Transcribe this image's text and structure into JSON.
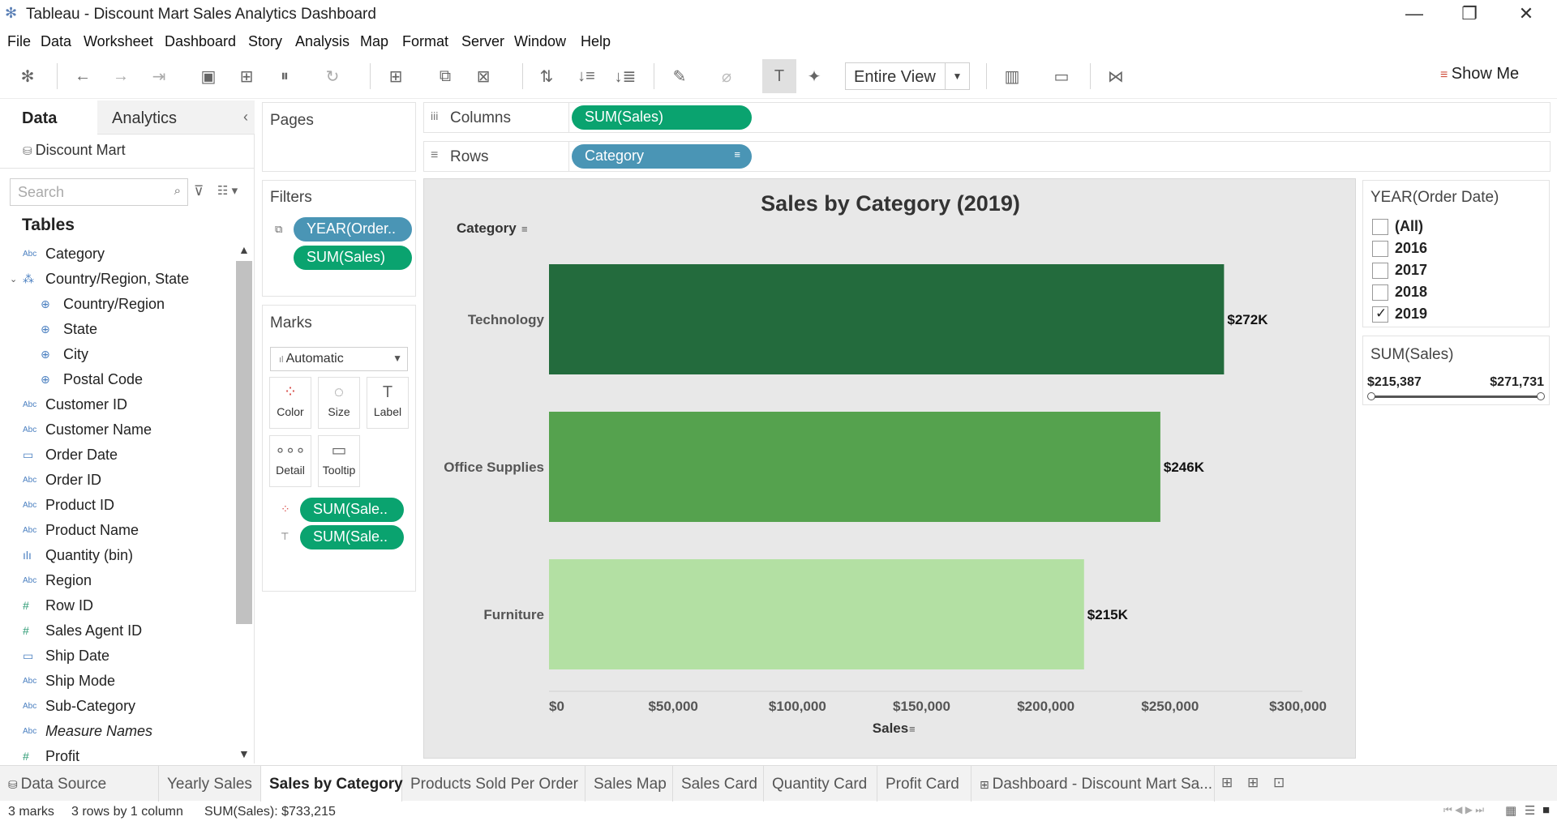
{
  "window": {
    "title": "Tableau - Discount Mart Sales Analytics Dashboard",
    "min": "—",
    "max": "❐",
    "close": "✕"
  },
  "menu": [
    "File",
    "Data",
    "Worksheet",
    "Dashboard",
    "Story",
    "Analysis",
    "Map",
    "Format",
    "Server",
    "Window",
    "Help"
  ],
  "toolbar": {
    "fit": "Entire View",
    "show_me": "Show Me"
  },
  "data_pane": {
    "tab_data": "Data",
    "tab_analytics": "Analytics",
    "collapse": "‹",
    "datasource": "Discount Mart",
    "search_placeholder": "Search",
    "tables_heading": "Tables",
    "fields": [
      {
        "icon": "Abc",
        "label": "Category"
      },
      {
        "icon": "⁂",
        "label": "Country/Region, State"
      },
      {
        "icon": "⊕",
        "label": "Country/Region"
      },
      {
        "icon": "⊕",
        "label": "State"
      },
      {
        "icon": "⊕",
        "label": "City"
      },
      {
        "icon": "⊕",
        "label": "Postal Code"
      },
      {
        "icon": "Abc",
        "label": "Customer ID"
      },
      {
        "icon": "Abc",
        "label": "Customer Name"
      },
      {
        "icon": "▭",
        "label": "Order Date"
      },
      {
        "icon": "Abc",
        "label": "Order ID"
      },
      {
        "icon": "Abc",
        "label": "Product ID"
      },
      {
        "icon": "Abc",
        "label": "Product Name"
      },
      {
        "icon": "ılı",
        "label": "Quantity (bin)"
      },
      {
        "icon": "Abc",
        "label": "Region"
      },
      {
        "icon": "#",
        "label": "Row ID"
      },
      {
        "icon": "#",
        "label": "Sales Agent ID"
      },
      {
        "icon": "▭",
        "label": "Ship Date"
      },
      {
        "icon": "Abc",
        "label": "Ship Mode"
      },
      {
        "icon": "Abc",
        "label": "Sub-Category"
      },
      {
        "icon": "Abc",
        "label": "Measure Names"
      },
      {
        "icon": "#",
        "label": "Profit"
      }
    ]
  },
  "cards": {
    "pages": "Pages",
    "filters": "Filters",
    "filter_pills": [
      "YEAR(Order..",
      "SUM(Sales)"
    ],
    "marks": "Marks",
    "mark_type": "Automatic",
    "mark_buttons": [
      "Color",
      "Size",
      "Label",
      "Detail",
      "Tooltip"
    ],
    "mark_pills": [
      "SUM(Sale..",
      "SUM(Sale.."
    ]
  },
  "shelves": {
    "columns_label": "Columns",
    "columns_pill": "SUM(Sales)",
    "rows_label": "Rows",
    "rows_pill": "Category"
  },
  "chart_data": {
    "type": "bar",
    "title": "Sales by Category (2019)",
    "ylabel": "Category",
    "xlabel": "Sales",
    "categories": [
      "Technology",
      "Office Supplies",
      "Furniture"
    ],
    "values": [
      271731,
      246097,
      215387
    ],
    "data_labels": [
      "$272K",
      "$246K",
      "$215K"
    ],
    "colors": [
      "#236b3d",
      "#55a24e",
      "#b3e0a3"
    ],
    "xlim": [
      0,
      300000
    ],
    "ticks": [
      0,
      50000,
      100000,
      150000,
      200000,
      250000,
      300000
    ],
    "tick_labels": [
      "$0",
      "$50,000",
      "$100,000",
      "$150,000",
      "$200,000",
      "$250,000",
      "$300,000"
    ]
  },
  "year_filter": {
    "title": "YEAR(Order Date)",
    "options": [
      {
        "label": "(All)",
        "checked": false
      },
      {
        "label": "2016",
        "checked": false
      },
      {
        "label": "2017",
        "checked": false
      },
      {
        "label": "2018",
        "checked": false
      },
      {
        "label": "2019",
        "checked": true
      }
    ]
  },
  "sales_filter": {
    "title": "SUM(Sales)",
    "min": "$215,387",
    "max": "$271,731"
  },
  "sheet_tabs": {
    "datasource": "Data Source",
    "tabs": [
      "Yearly Sales",
      "Sales by Category",
      "Products Sold Per Order",
      "Sales Map",
      "Sales Card",
      "Quantity Card",
      "Profit Card",
      "Dashboard - Discount Mart Sa..."
    ],
    "active": 1
  },
  "status": {
    "marks": "3 marks",
    "dims": "3 rows by 1 column",
    "sum": "SUM(Sales): $733,215"
  }
}
